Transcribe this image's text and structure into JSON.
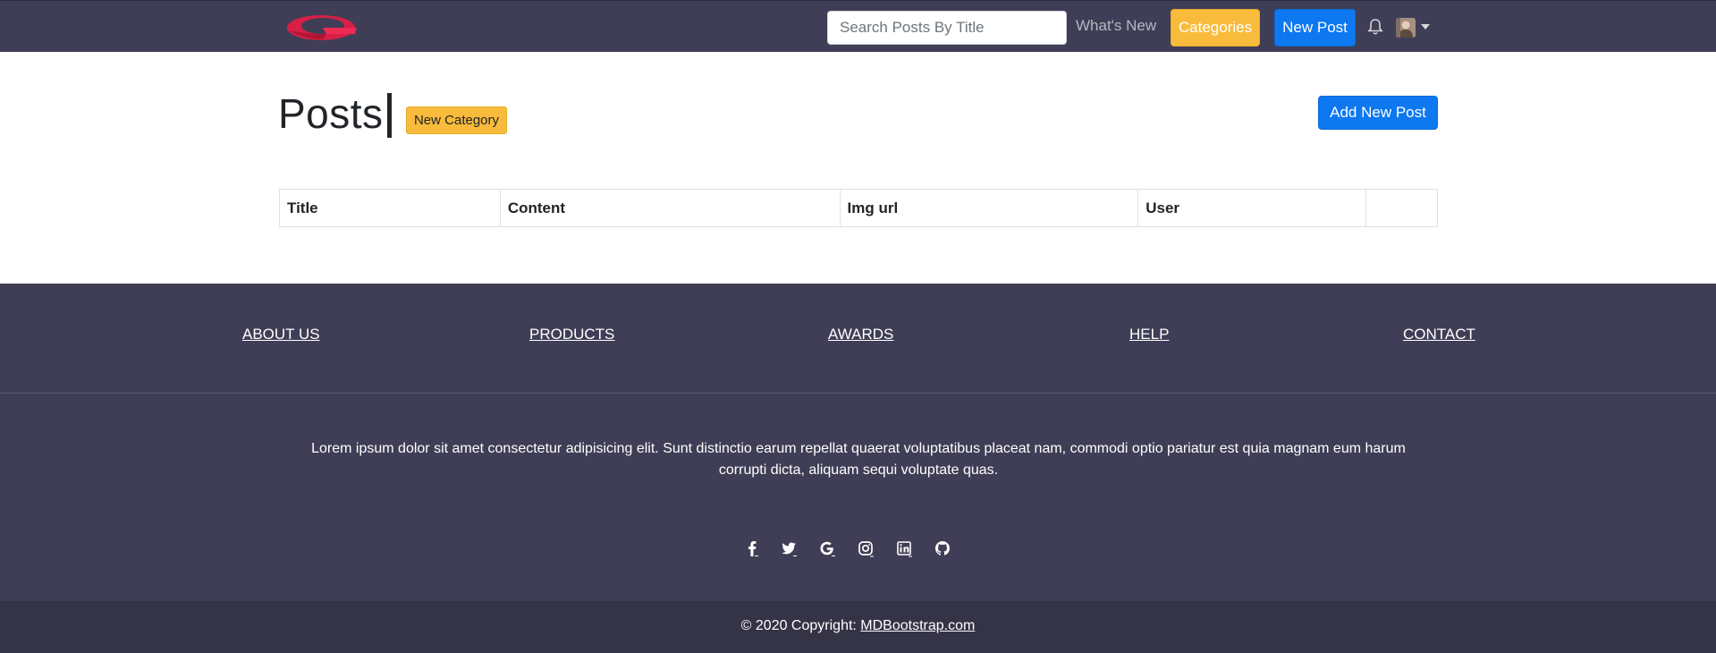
{
  "navbar": {
    "logo": "logo",
    "search_placeholder": "Search Posts By Title",
    "whats_new": "What's New",
    "categories": "Categories",
    "new_post": "New Post",
    "bell_icon": "bell-icon",
    "avatar": "user-avatar"
  },
  "main": {
    "title": "Posts",
    "new_category": "New Category",
    "add_new_post": "Add New Post",
    "table": {
      "columns": [
        "Title",
        "Content",
        "Img url",
        "User",
        ""
      ]
    }
  },
  "footer": {
    "links": [
      "ABOUT US",
      "PRODUCTS",
      "AWARDS",
      "HELP",
      "CONTACT"
    ],
    "text": "Lorem ipsum dolor sit amet consectetur adipisicing elit. Sunt distinctio earum repellat quaerat voluptatibus placeat nam, commodi optio pariatur est quia magnam eum harum corrupti dicta, aliquam sequi voluptate quas.",
    "social_icons": [
      "facebook-icon",
      "twitter-icon",
      "google-icon",
      "instagram-icon",
      "linkedin-icon",
      "github-icon"
    ],
    "copyright_prefix": "© 2020 Copyright: ",
    "copyright_link": "MDBootstrap.com"
  },
  "colors": {
    "navbar_bg": "#3f3e56",
    "warning": "#f9bb3b",
    "primary": "#0d78f0",
    "footer_bg": "#3f3e56",
    "copyright_bg": "#353447"
  }
}
